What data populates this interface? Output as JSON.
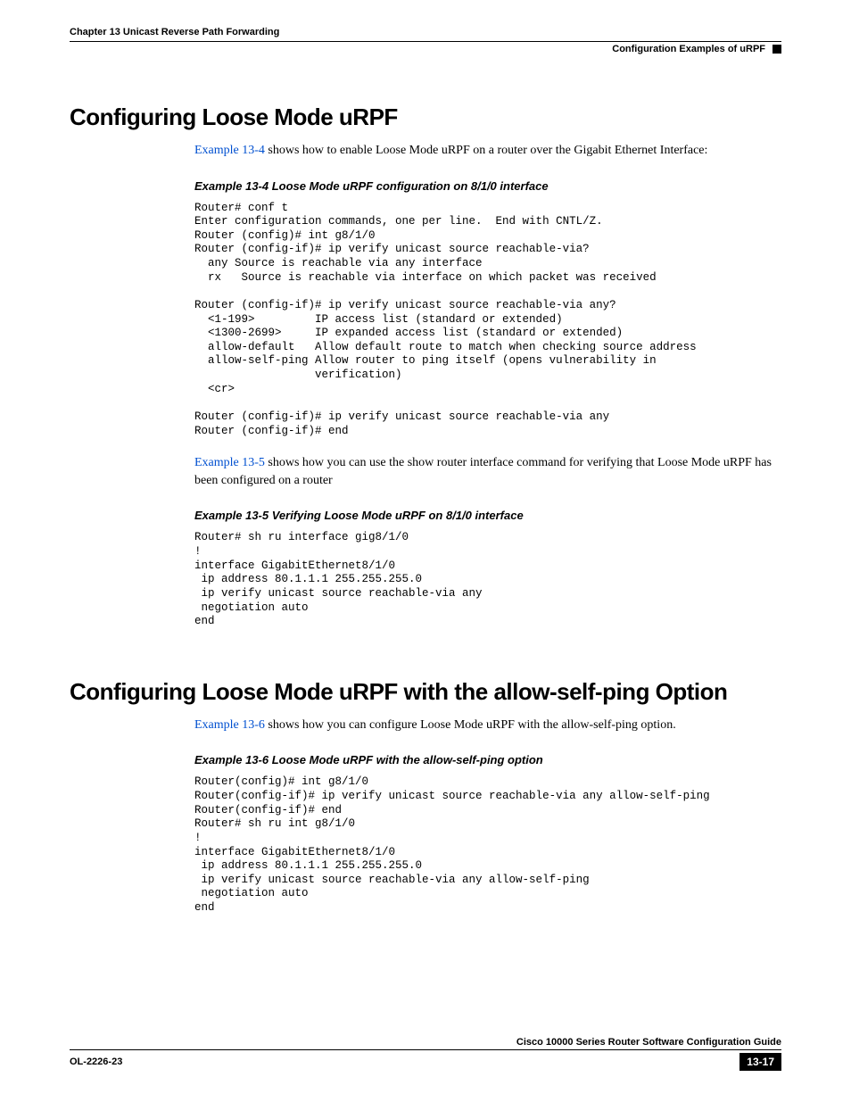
{
  "header": {
    "chapter": "Chapter 13    Unicast Reverse Path Forwarding",
    "right": "Configuration Examples of uRPF"
  },
  "section1": {
    "heading": "Configuring Loose Mode uRPF",
    "intro_link": "Example 13-4",
    "intro_rest": " shows how to enable Loose Mode uRPF on a router over the Gigabit Ethernet Interface:",
    "example1_title": "Example 13-4   Loose Mode uRPF configuration on 8/1/0 interface",
    "code1": "Router# conf t\nEnter configuration commands, one per line.  End with CNTL/Z.\nRouter (config)# int g8/1/0\nRouter (config-if)# ip verify unicast source reachable-via?\n  any Source is reachable via any interface\n  rx   Source is reachable via interface on which packet was received\n\nRouter (config-if)# ip verify unicast source reachable-via any?\n  <1-199>         IP access list (standard or extended)\n  <1300-2699>     IP expanded access list (standard or extended)\n  allow-default   Allow default route to match when checking source address\n  allow-self-ping Allow router to ping itself (opens vulnerability in\n                  verification)\n  <cr>\n\nRouter (config-if)# ip verify unicast source reachable-via any\nRouter (config-if)# end",
    "mid_link": "Example 13-5",
    "mid_rest": " shows how you can use the show router interface command for verifying that Loose Mode uRPF has been configured on a router",
    "example2_title": "Example 13-5   Verifying Loose Mode uRPF on 8/1/0 interface",
    "code2": "Router# sh ru interface gig8/1/0\n!\ninterface GigabitEthernet8/1/0\n ip address 80.1.1.1 255.255.255.0\n ip verify unicast source reachable-via any\n negotiation auto\nend"
  },
  "section2": {
    "heading": "Configuring Loose Mode uRPF with the allow-self-ping Option",
    "intro_link": "Example 13-6",
    "intro_rest": " shows how you can configure Loose Mode uRPF with the allow-self-ping option.",
    "example1_title": "Example 13-6   Loose Mode uRPF with the allow-self-ping option",
    "code1": "Router(config)# int g8/1/0\nRouter(config-if)# ip verify unicast source reachable-via any allow-self-ping\nRouter(config-if)# end\nRouter# sh ru int g8/1/0\n!\ninterface GigabitEthernet8/1/0\n ip address 80.1.1.1 255.255.255.0\n ip verify unicast source reachable-via any allow-self-ping\n negotiation auto\nend"
  },
  "footer": {
    "guide": "Cisco 10000 Series Router Software Configuration Guide",
    "doc_id": "OL-2226-23",
    "page": "13-17"
  }
}
